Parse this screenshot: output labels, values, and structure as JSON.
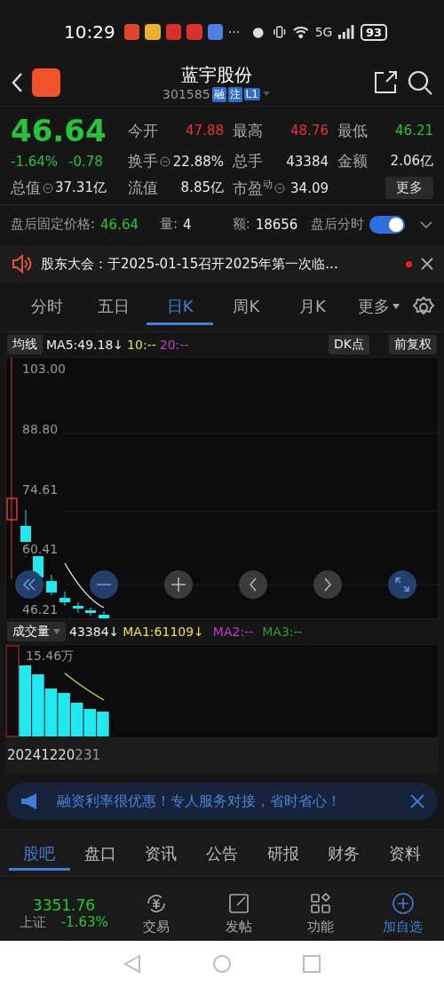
{
  "status_bar": {
    "time": "10:29",
    "more": "···",
    "network": "5G",
    "battery": "93"
  },
  "header": {
    "title": "蓝宇股份",
    "code": "301585",
    "tags": [
      "融",
      "注",
      "L1"
    ]
  },
  "quote": {
    "price": "46.64",
    "color": "#27c43a",
    "change_pct": "-1.64%",
    "change": "-0.78",
    "stats": [
      {
        "label": "今开",
        "value": "47.88",
        "color": "#e8313a",
        "info": false
      },
      {
        "label": "最高",
        "value": "48.76",
        "color": "#e8313a",
        "info": false
      },
      {
        "label": "最低",
        "value": "46.21",
        "color": "#27c43a",
        "info": false
      },
      {
        "label": "换手",
        "value": "22.88%",
        "color": "#e8e8e8",
        "info": true
      },
      {
        "label": "总手",
        "value": "43384",
        "color": "#e8e8e8",
        "info": false
      },
      {
        "label": "金额",
        "value": "2.06亿",
        "color": "#e8e8e8",
        "info": false
      },
      {
        "label": "总值",
        "value": "37.31亿",
        "color": "#e8e8e8",
        "info": true
      },
      {
        "label": "流值",
        "value": "8.85亿",
        "color": "#e8e8e8",
        "info": false
      },
      {
        "label": "市盈$^{动}$",
        "value": "34.09",
        "color": "#e8e8e8",
        "info": true
      }
    ],
    "more_button": "更多"
  },
  "after_hours": {
    "label": "盘后固定价格:",
    "price": "46.64",
    "volume_label": "量:",
    "volume": "4",
    "amount_label": "额:",
    "amount": "18656",
    "toggle_label": "盘后分时",
    "toggle_on": true
  },
  "notice": {
    "text": "股东大会：于2025-01-15召开2025年第一次临...",
    "unread": true
  },
  "period_tabs": [
    {
      "label": "分时",
      "selected": false,
      "kind": "tab"
    },
    {
      "label": "五日",
      "selected": false,
      "kind": "tab"
    },
    {
      "label": "日K",
      "selected": true,
      "kind": "tab"
    },
    {
      "label": "周K",
      "selected": false,
      "kind": "tab"
    },
    {
      "label": "月K",
      "selected": false,
      "kind": "tab"
    },
    {
      "label": "更多",
      "selected": false,
      "kind": "dropdown"
    }
  ],
  "indicator_bar": {
    "selector": "均线",
    "ma5": "MA5:49.18",
    "ma5_arrow": "↓",
    "ma10": "10:--",
    "ma20": "20:--",
    "dk_button": "DK点",
    "adjust_button": "前复权"
  },
  "price_chart": {
    "axis_labels": [
      "103.00",
      "88.80",
      "74.61",
      "60.41",
      "46.21"
    ]
  },
  "volume": {
    "selector": "成交量",
    "value": "43384",
    "arrow": "↓",
    "ma1": "MA1:61109",
    "ma1_arrow": "↓",
    "ma2": "MA2:--",
    "ma3": "MA3:--",
    "max_label": "15.46万",
    "date": "20241220",
    "date_tail": "231"
  },
  "ad": {
    "text": "融资利率很优惠！专人服务对接，省时省心！"
  },
  "bottom_tabs": [
    {
      "label": "股吧",
      "selected": true
    },
    {
      "label": "盘口",
      "selected": false
    },
    {
      "label": "资讯",
      "selected": false
    },
    {
      "label": "公告",
      "selected": false
    },
    {
      "label": "研报",
      "selected": false
    },
    {
      "label": "财务",
      "selected": false
    },
    {
      "label": "资料",
      "selected": false
    }
  ],
  "index": {
    "value": "3351.76",
    "name": "上证",
    "change": "-1.63%",
    "color": "#27c43a"
  },
  "actions": [
    {
      "label": "交易",
      "kind": "trade",
      "highlighted": false
    },
    {
      "label": "发帖",
      "kind": "post",
      "highlighted": false
    },
    {
      "label": "功能",
      "kind": "apps",
      "highlighted": false
    },
    {
      "label": "加自选",
      "kind": "add",
      "highlighted": true
    }
  ]
}
